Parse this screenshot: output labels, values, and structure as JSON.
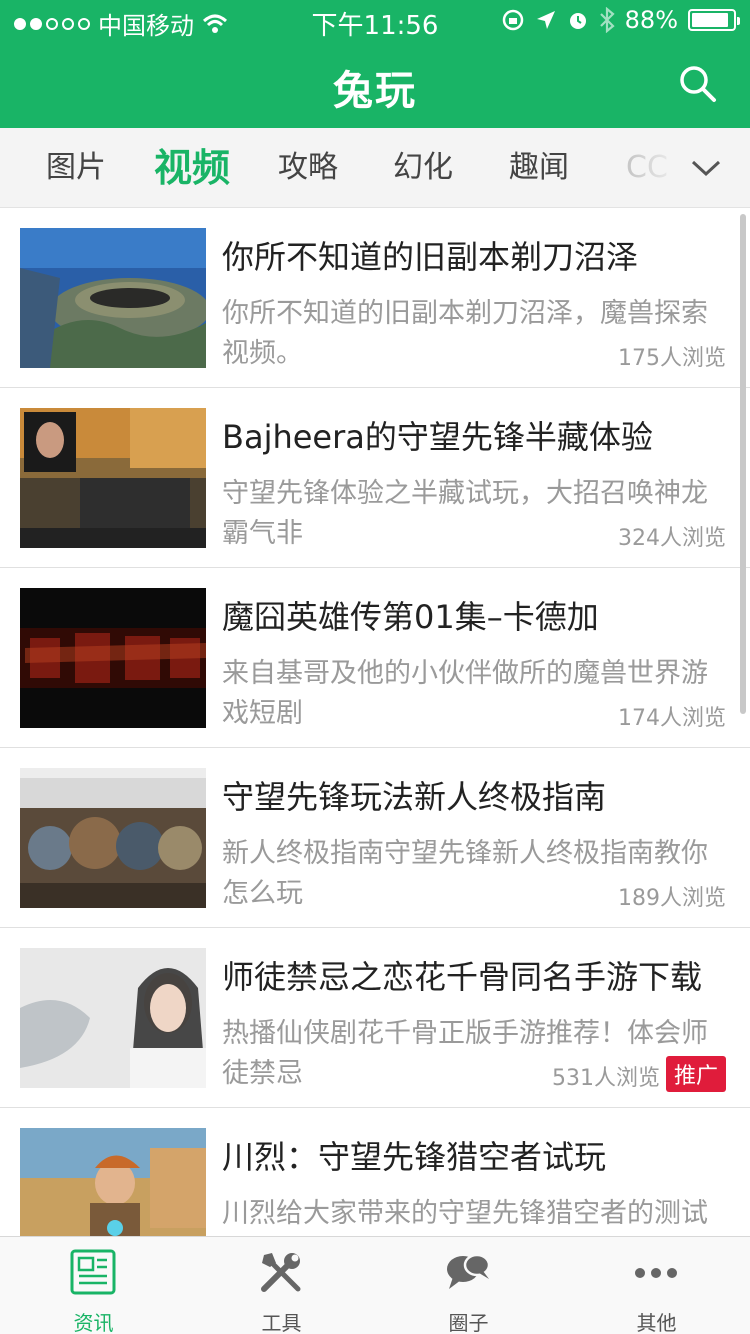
{
  "status_bar": {
    "carrier": "中国移动",
    "time": "下午11:56",
    "battery": "88%"
  },
  "header": {
    "title": "兔玩"
  },
  "tabs": [
    {
      "label": "图片"
    },
    {
      "label": "视频"
    },
    {
      "label": "攻略"
    },
    {
      "label": "幻化"
    },
    {
      "label": "趣闻"
    },
    {
      "label": "CC"
    }
  ],
  "items": [
    {
      "title": "你所不知道的旧副本剃刀沼泽",
      "desc": "你所不知道的旧副本剃刀沼泽，魔兽探索视频。",
      "views": "175人浏览"
    },
    {
      "title": "Bajheera的守望先锋半藏体验",
      "desc": "守望先锋体验之半藏试玩，大招召唤神龙霸气非",
      "views": "324人浏览"
    },
    {
      "title": "魔囧英雄传第01集–卡德加",
      "desc": "来自基哥及他的小伙伴做所的魔兽世界游戏短剧",
      "views": "174人浏览"
    },
    {
      "title": "守望先锋玩法新人终极指南",
      "desc": "新人终极指南守望先锋新人终极指南教你怎么玩",
      "views": "189人浏览"
    },
    {
      "title": "师徒禁忌之恋花千骨同名手游下载",
      "desc": "热播仙侠剧花千骨正版手游推荐！体会师徒禁忌",
      "views": "531人浏览",
      "badge": "推广"
    },
    {
      "title": "川烈：守望先锋猎空者试玩",
      "desc": "川烈给大家带来的守望先锋猎空者的测试",
      "views": ""
    }
  ],
  "bottom_nav": [
    {
      "label": "资讯"
    },
    {
      "label": "工具"
    },
    {
      "label": "圈子"
    },
    {
      "label": "其他"
    }
  ],
  "colors": {
    "brand": "#19b466",
    "badge": "#e01c3b"
  }
}
